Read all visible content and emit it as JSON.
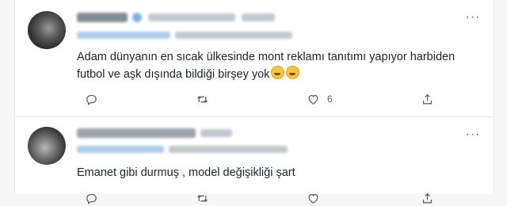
{
  "tweets": [
    {
      "id": "t1",
      "text": "Adam dünyanın en sıcak ülkesinde mont reklamı tanıtımı yapıyor harbiden futbol ve aşk dışında bildiği birşey yok",
      "emojis": [
        "laughing-tears",
        "laughing-tears"
      ],
      "reply_count": "",
      "retweet_count": "",
      "like_count": "6",
      "more_label": "···",
      "author_blurred": true
    },
    {
      "id": "t2",
      "text": "Emanet gibi durmuş , model değişikliği şart",
      "emojis": [],
      "reply_count": "",
      "retweet_count": "",
      "like_count": "",
      "more_label": "···",
      "author_blurred": true
    }
  ],
  "icons": {
    "reply": "reply-icon",
    "retweet": "retweet-icon",
    "like": "heart-icon",
    "share": "share-icon",
    "more": "more-icon"
  },
  "colors": {
    "text": "#0f1419",
    "secondary": "#536471",
    "divider": "#e3e3e3",
    "link": "#1d9bf0"
  }
}
